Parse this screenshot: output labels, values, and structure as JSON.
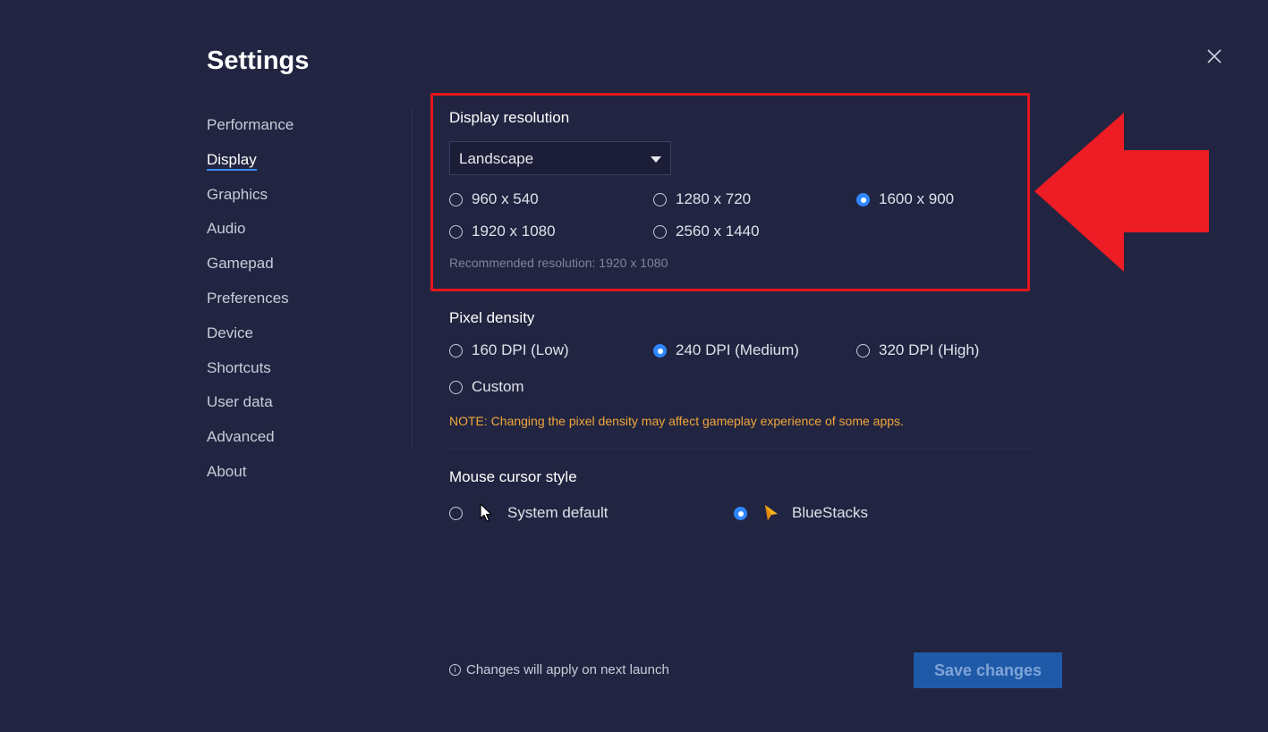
{
  "title": "Settings",
  "sidebar": {
    "items": [
      {
        "label": "Performance",
        "active": false
      },
      {
        "label": "Display",
        "active": true
      },
      {
        "label": "Graphics",
        "active": false
      },
      {
        "label": "Audio",
        "active": false
      },
      {
        "label": "Gamepad",
        "active": false
      },
      {
        "label": "Preferences",
        "active": false
      },
      {
        "label": "Device",
        "active": false
      },
      {
        "label": "Shortcuts",
        "active": false
      },
      {
        "label": "User data",
        "active": false
      },
      {
        "label": "Advanced",
        "active": false
      },
      {
        "label": "About",
        "active": false
      }
    ]
  },
  "display_resolution": {
    "title": "Display resolution",
    "orientation": "Landscape",
    "options": [
      "960 x 540",
      "1280 x 720",
      "1600 x 900",
      "1920 x 1080",
      "2560 x 1440"
    ],
    "selected": "1600 x 900",
    "recommended": "Recommended resolution: 1920 x 1080"
  },
  "pixel_density": {
    "title": "Pixel density",
    "options": [
      "160 DPI (Low)",
      "240 DPI (Medium)",
      "320 DPI (High)",
      "Custom"
    ],
    "selected": "240 DPI (Medium)",
    "note": "NOTE: Changing the pixel density may affect gameplay experience of some apps."
  },
  "mouse_cursor": {
    "title": "Mouse cursor style",
    "options": [
      "System default",
      "BlueStacks"
    ],
    "selected": "BlueStacks"
  },
  "footer": {
    "info": "Changes will apply on next launch",
    "info_icon": "i",
    "save_label": "Save changes"
  },
  "colors": {
    "background": "#222541",
    "accent": "#2f86ff",
    "highlight": "#e3161c",
    "note": "#f0a63a",
    "save_button": "#1f5aa8"
  }
}
